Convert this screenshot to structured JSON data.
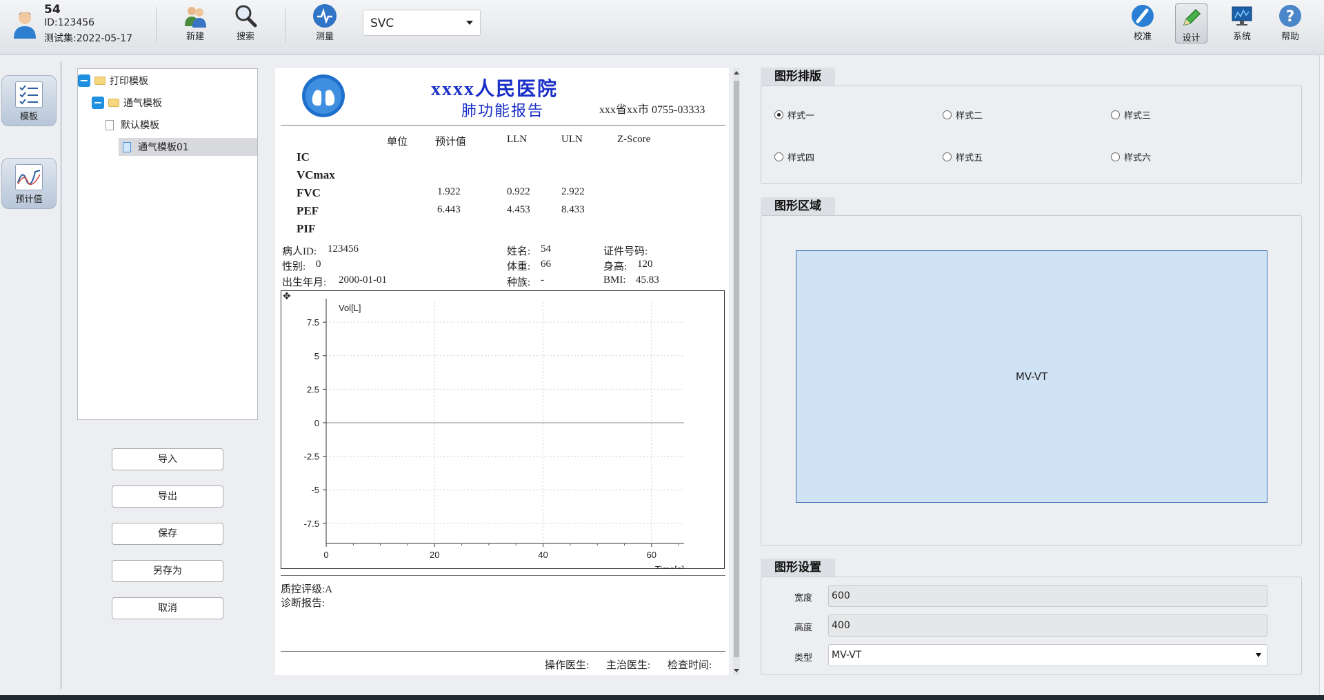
{
  "user": {
    "name": "54",
    "id_line": "ID:123456",
    "test_line": "测试集:2022-05-17"
  },
  "toolbar": {
    "new_label": "新建",
    "search_label": "搜索",
    "measure_label": "测量",
    "mode_value": "SVC",
    "calibrate_label": "校准",
    "design_label": "设计",
    "system_label": "系统",
    "help_label": "帮助"
  },
  "nav": {
    "template_label": "模板",
    "predicted_label": "预计值"
  },
  "tree": [
    {
      "label": "打印模板",
      "level": 0,
      "type": "folder",
      "expanded": true
    },
    {
      "label": "通气模板",
      "level": 1,
      "type": "folder",
      "expanded": true
    },
    {
      "label": "默认模板",
      "level": 2,
      "type": "file"
    },
    {
      "label": "通气模板01",
      "level": 2,
      "type": "file",
      "selected": true
    }
  ],
  "actions": {
    "import": "导入",
    "export": "导出",
    "save": "保存",
    "save_as": "另存为",
    "cancel": "取消"
  },
  "report": {
    "hospital": "xxxx人民医院",
    "subtitle": "肺功能报告",
    "address": "xxx省xx市 0755-03333",
    "headers": [
      "单位",
      "预计值",
      "LLN",
      "ULN",
      "Z-Score"
    ],
    "rows": [
      {
        "param": "IC",
        "pred": "",
        "lln": "",
        "uln": ""
      },
      {
        "param": "VCmax",
        "pred": "",
        "lln": "",
        "uln": ""
      },
      {
        "param": "FVC",
        "pred": "1.922",
        "lln": "0.922",
        "uln": "2.922"
      },
      {
        "param": "PEF",
        "pred": "6.443",
        "lln": "4.453",
        "uln": "8.433"
      },
      {
        "param": "PIF",
        "pred": "",
        "lln": "",
        "uln": ""
      }
    ],
    "patient": {
      "id_label": "病人ID:",
      "id_value": "123456",
      "name_label": "姓名:",
      "name_value": "54",
      "cert_label": "证件号码:",
      "sex_label": "性别:",
      "sex_value": "0",
      "weight_label": "体重:",
      "weight_value": "66",
      "height_label": "身高:",
      "height_value": "120",
      "dob_label": "出生年月:",
      "dob_value": "2000-01-01",
      "race_label": "种族:",
      "race_value": "-",
      "bmi_label": "BMI:",
      "bmi_value": "45.83"
    },
    "qc": "质控评级:A",
    "diagnosis": "诊断报告:",
    "footer": {
      "operator": "操作医生:",
      "chief": "主治医生:",
      "exam_time": "检查时间:"
    }
  },
  "chart_data": {
    "type": "line",
    "ylabel": "Vol[L]",
    "xlabel": "Time[s]",
    "xlim": [
      0,
      66
    ],
    "ylim": [
      -9,
      9
    ],
    "x_ticks": [
      0,
      20,
      40,
      60
    ],
    "y_ticks": [
      7.5,
      5,
      2.5,
      0,
      -2.5,
      -5,
      -7.5
    ],
    "grid": true,
    "series": []
  },
  "panel": {
    "layout_title": "图形排版",
    "styles": [
      {
        "label": "样式一",
        "checked": true
      },
      {
        "label": "样式二",
        "checked": false
      },
      {
        "label": "样式三",
        "checked": false
      },
      {
        "label": "样式四",
        "checked": false
      },
      {
        "label": "样式五",
        "checked": false
      },
      {
        "label": "样式六",
        "checked": false
      }
    ],
    "area_title": "图形区域",
    "area_box_label": "MV-VT",
    "settings_title": "图形设置",
    "width_label": "宽度",
    "width_value": "600",
    "height_label": "高度",
    "height_value": "400",
    "type_label": "类型",
    "type_value": "MV-VT"
  },
  "colors": {
    "hospital_title": "#1a2fc8",
    "area_fill": "#cfe3f5",
    "area_border": "#3b6fb6",
    "selected_row": "#d8d9dc"
  }
}
